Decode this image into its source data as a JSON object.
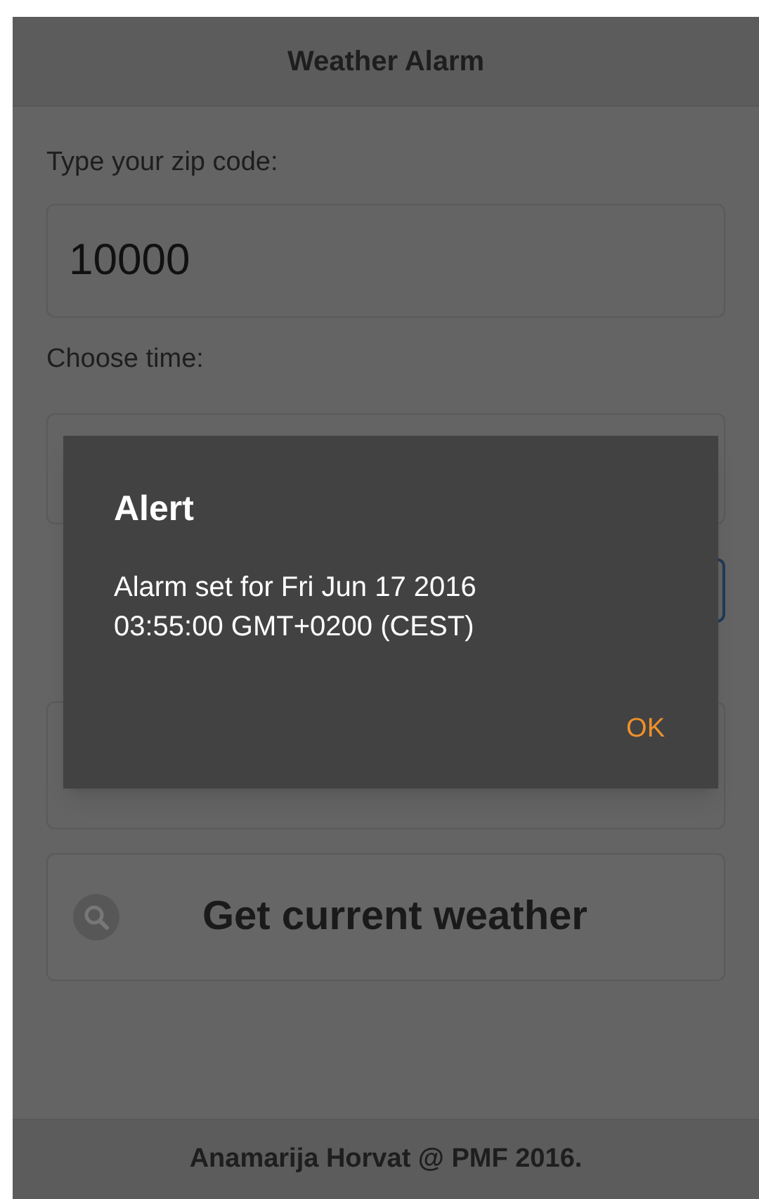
{
  "header": {
    "title": "Weather Alarm"
  },
  "form": {
    "zip_label": "Type your zip code:",
    "zip_value": "10000",
    "time_label": "Choose time:"
  },
  "weather_button": {
    "label": "Get current weather"
  },
  "footer": {
    "text": "Anamarija Horvat @ PMF 2016."
  },
  "dialog": {
    "title": "Alert",
    "message": "Alarm set for Fri Jun 17 2016 03:55:00 GMT+0200 (CEST)",
    "buttons": [
      "OK"
    ]
  }
}
